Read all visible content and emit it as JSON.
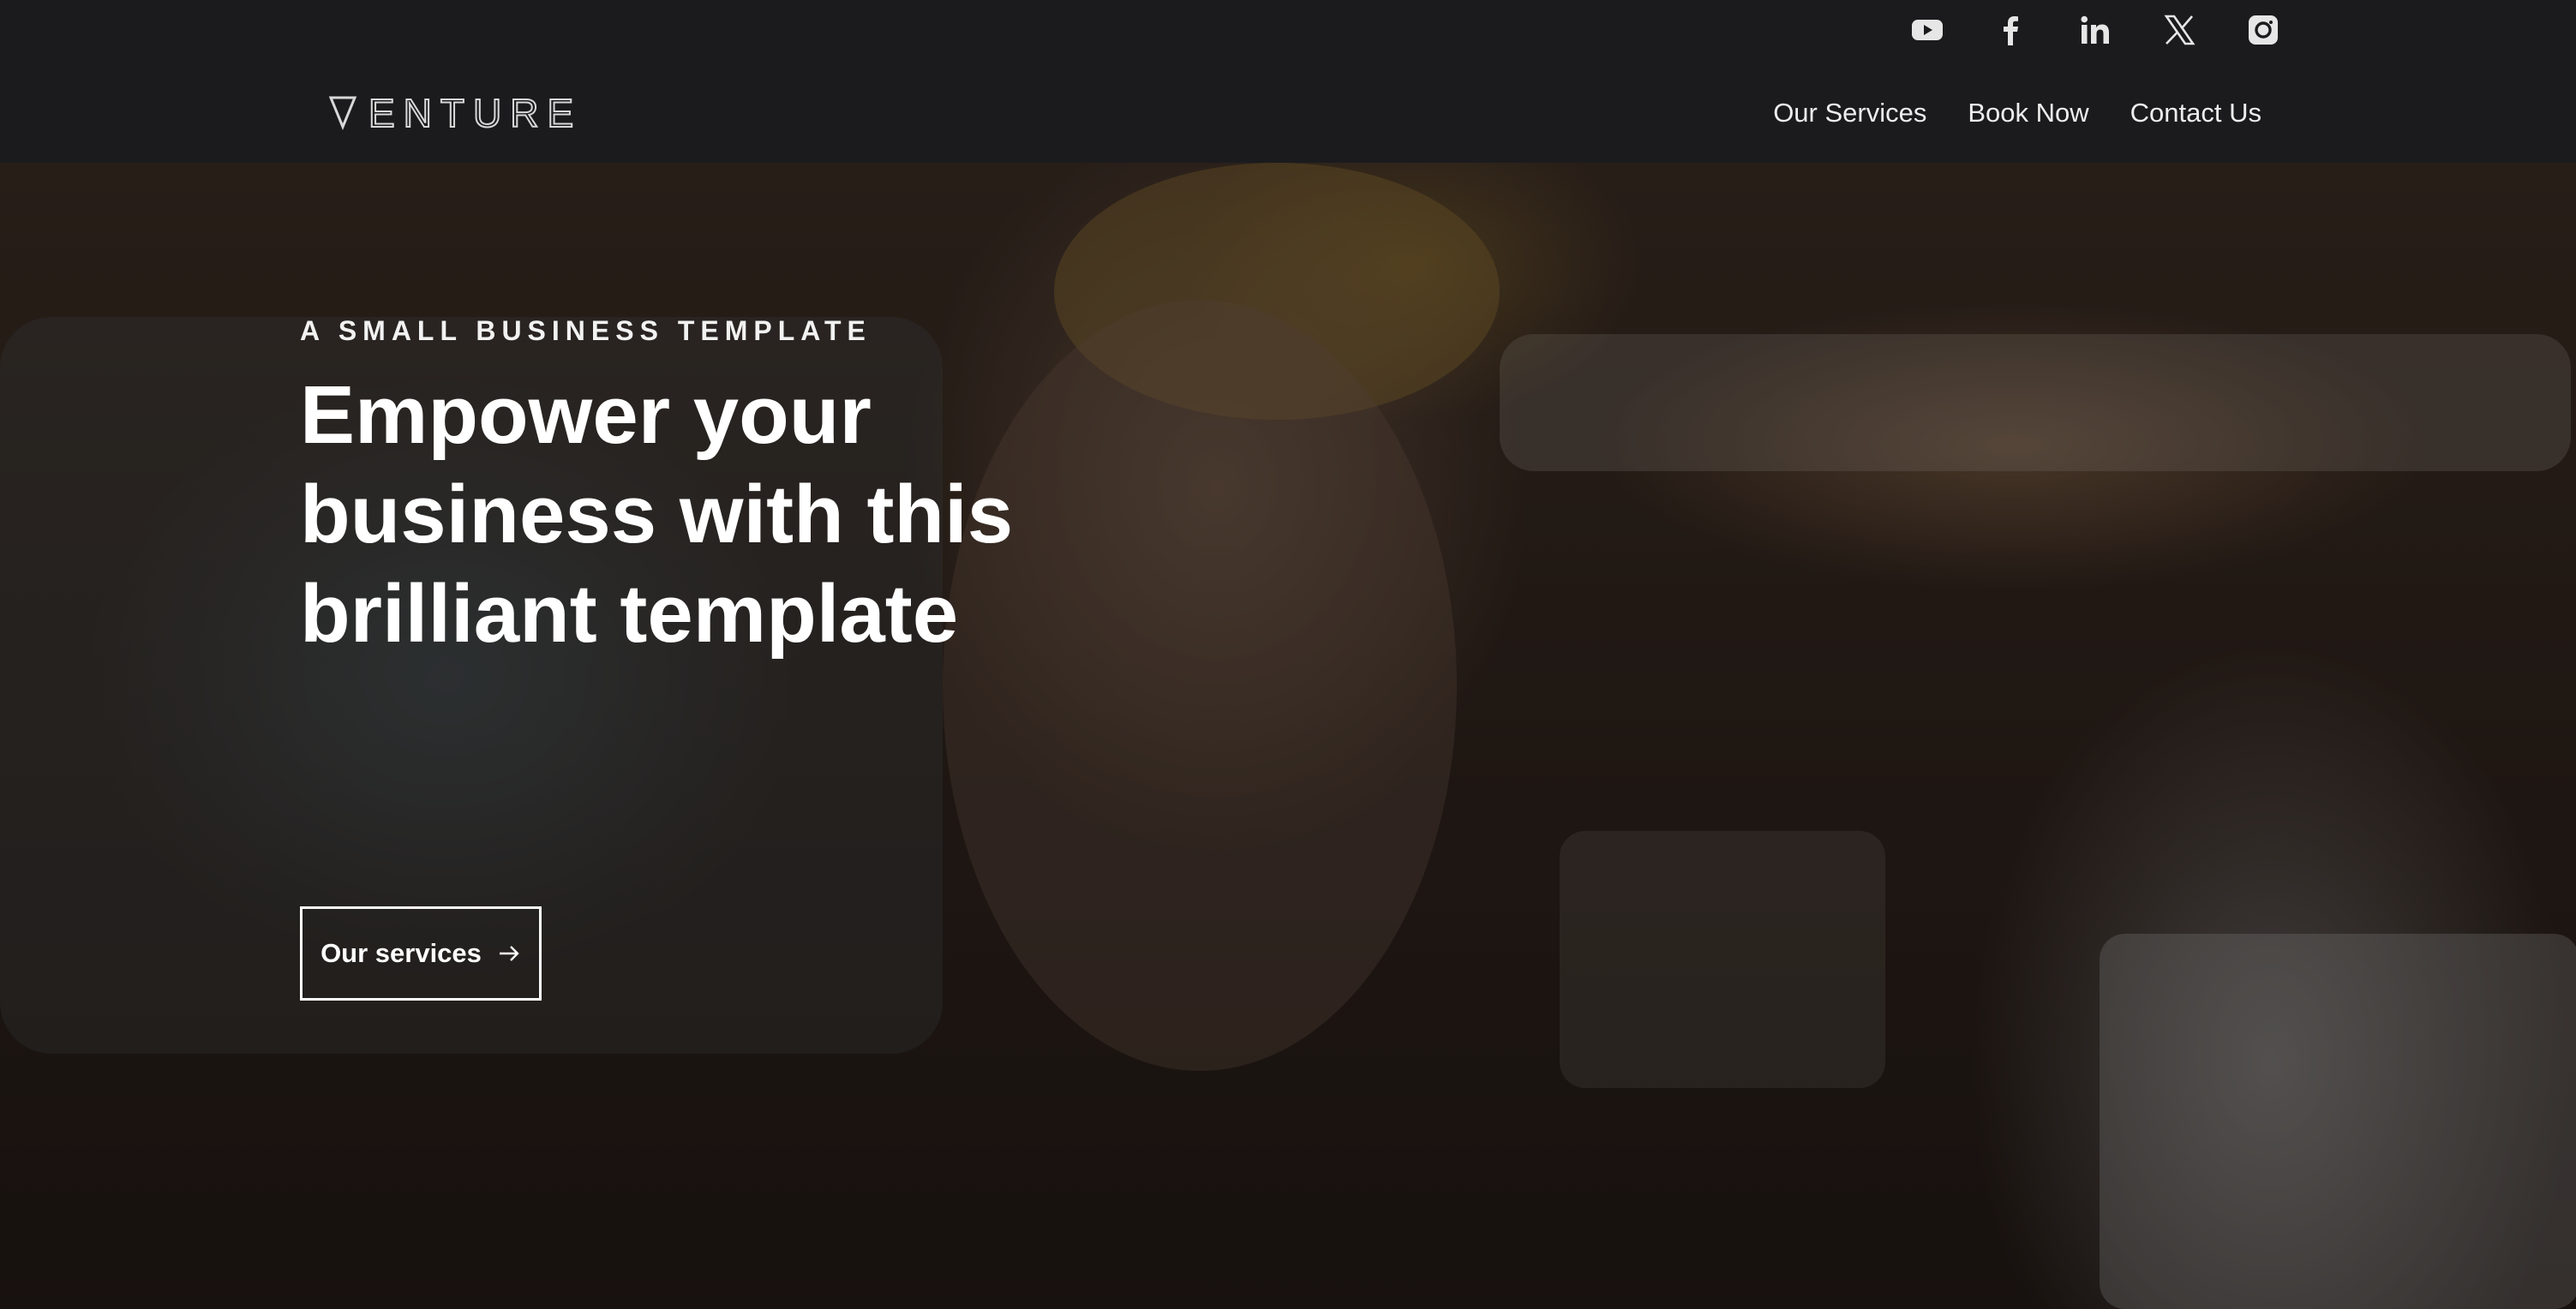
{
  "header": {
    "logo_text": "VENTURE",
    "social_icons": [
      "youtube-icon",
      "facebook-icon",
      "linkedin-icon",
      "x-icon",
      "instagram-icon"
    ],
    "nav": [
      {
        "label": "Our Services"
      },
      {
        "label": "Book Now"
      },
      {
        "label": "Contact Us"
      }
    ]
  },
  "hero": {
    "eyebrow": "A SMALL BUSINESS TEMPLATE",
    "headline": "Empower your business with this brilliant template",
    "cta_label": "Our services",
    "cta_icon": "arrow-right-icon"
  },
  "colors": {
    "header_bg": "#1b1b1e",
    "text": "#ffffff",
    "nav_text": "#ededed"
  }
}
